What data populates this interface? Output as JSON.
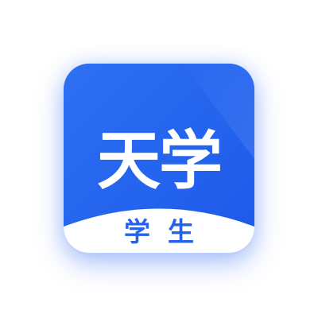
{
  "logo": {
    "title": "天学",
    "subtitle": "学生"
  },
  "colors": {
    "background": "#ffffff",
    "icon_blue": "#2464ee",
    "icon_blue_light": "#3a7af5",
    "arc_white": "#ffffff",
    "subtitle_blue": "#2563ea",
    "title_white": "#ffffff"
  }
}
